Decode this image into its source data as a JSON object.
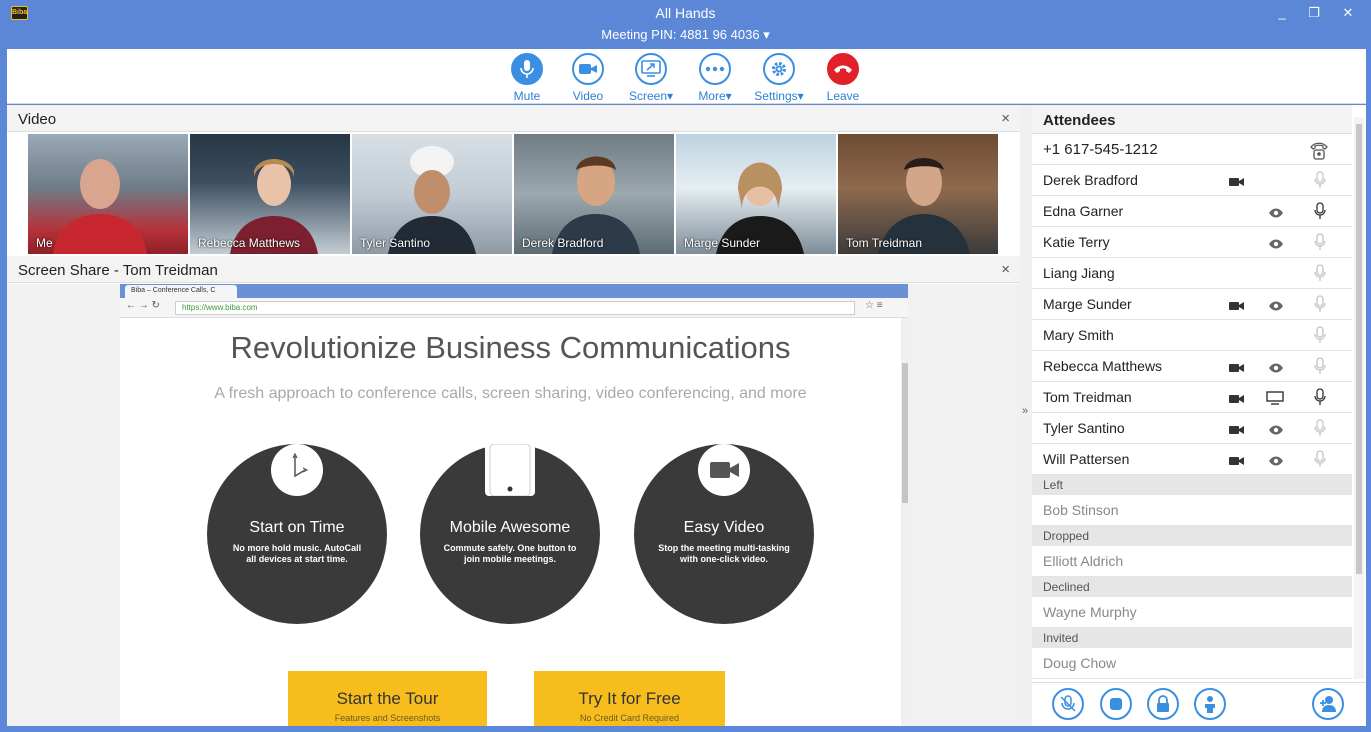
{
  "window": {
    "title": "All Hands",
    "pin_label": "Meeting PIN: 4881 96 4036",
    "logo_text": "Biba",
    "minimize": "_",
    "restore": "❐",
    "close": "✕"
  },
  "toolbar": [
    {
      "label": "Mute",
      "icon": "mic-icon"
    },
    {
      "label": "Video",
      "icon": "camera-icon"
    },
    {
      "label": "Screen▾",
      "icon": "screen-icon"
    },
    {
      "label": "More▾",
      "icon": "more-icon"
    },
    {
      "label": "Settings▾",
      "icon": "gear-icon"
    },
    {
      "label": "Leave",
      "icon": "phone-hangup-icon"
    }
  ],
  "video_panel": {
    "title": "Video",
    "close": "×",
    "tiles": [
      "Me",
      "Rebecca Matthews",
      "Tyler Santino",
      "Derek Bradford",
      "Marge Sunder",
      "Tom Treidman"
    ]
  },
  "screen_share": {
    "title": "Screen Share - Tom Treidman",
    "close": "×",
    "browser_tab": "Biba – Conference Calls, C",
    "url": "https://www.biba.com",
    "hero": "Revolutionize Business Communications",
    "subtitle": "A fresh approach to conference calls, screen sharing, video conferencing, and more",
    "features": [
      {
        "title": "Start on Time",
        "desc": "No more hold music. AutoCall all devices at start time."
      },
      {
        "title": "Mobile Awesome",
        "desc": "Commute safely. One button to join mobile meetings."
      },
      {
        "title": "Easy Video",
        "desc": "Stop the meeting multi-tasking with one-click video."
      }
    ],
    "cta": [
      {
        "main": "Start the Tour",
        "sub": "Features and Screenshots"
      },
      {
        "main": "Try It for Free",
        "sub": "No Credit Card Required"
      }
    ]
  },
  "attendees": {
    "title": "Attendees",
    "phone": "+1 617-545-1212",
    "active": [
      "Derek Bradford",
      "Edna Garner",
      "Katie Terry",
      "Liang Jiang",
      "Marge Sunder",
      "Mary Smith",
      "Rebecca Matthews",
      "Tom Treidman",
      "Tyler Santino",
      "Will Pattersen"
    ],
    "sections": [
      {
        "label": "Left",
        "name": "Bob Stinson"
      },
      {
        "label": "Dropped",
        "name": "Elliott Aldrich"
      },
      {
        "label": "Declined",
        "name": "Wayne Murphy"
      },
      {
        "label": "Invited",
        "name": "Doug Chow"
      }
    ]
  },
  "colors": {
    "accent": "#3a8fe2",
    "titlebar": "#5b87d6",
    "leave": "#e0212a",
    "cta": "#f6bd1c"
  }
}
